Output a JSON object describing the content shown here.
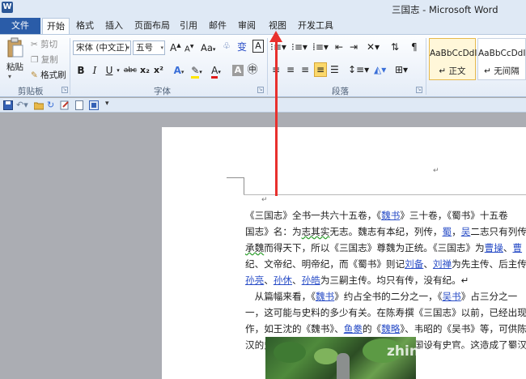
{
  "window": {
    "title": "三国志 - Microsoft Word",
    "app_icon": "W"
  },
  "tabs": {
    "file": "文件",
    "items": [
      "开始",
      "格式",
      "插入",
      "页面布局",
      "引用",
      "邮件",
      "审阅",
      "视图",
      "开发工具"
    ],
    "active": "开始"
  },
  "ribbon": {
    "clipboard": {
      "label": "剪贴板",
      "paste": "粘贴",
      "cut": "剪切",
      "copy": "复制",
      "format_painter": "格式刷"
    },
    "font": {
      "label": "字体",
      "font_name": "宋体 (中文正)",
      "font_size": "五号",
      "bold": "B",
      "italic": "I",
      "underline": "U",
      "strike": "abc",
      "subscript": "x₂",
      "superscript": "x²",
      "grow": "A",
      "shrink": "A",
      "change_case": "Aa",
      "phonetic": "wén",
      "char_border": "A"
    },
    "paragraph": {
      "label": "段落"
    },
    "styles": {
      "items": [
        {
          "sample": "AaBbCcDdI",
          "name": "↵ 正文",
          "selected": true
        },
        {
          "sample": "AaBbCcDdI",
          "name": "↵ 无间隔",
          "selected": false
        }
      ]
    }
  },
  "document": {
    "lines": [
      {
        "parts": [
          [
            "t",
            "《三国志》全书一共六十五卷，《"
          ],
          [
            "l",
            "魏书"
          ],
          [
            "t",
            "》三十卷，《蜀书》十五卷"
          ]
        ]
      },
      {
        "parts": [
          [
            "t",
            "国志》名：为"
          ],
          [
            "w",
            "志其实"
          ],
          [
            "t",
            "无志。魏志有本纪，列传，"
          ],
          [
            "l",
            "蜀"
          ],
          [
            "t",
            "，"
          ],
          [
            "l",
            "吴"
          ],
          [
            "t",
            "二志只有列传"
          ]
        ]
      },
      {
        "parts": [
          [
            "w",
            "承魏"
          ],
          [
            "t",
            "而得天下，所以《三国志》尊魏为正统。《三国志》为"
          ],
          [
            "l",
            "曹操"
          ],
          [
            "t",
            "、"
          ],
          [
            "l",
            "曹"
          ]
        ]
      },
      {
        "parts": [
          [
            "t",
            "纪、文帝纪、明帝纪，而《蜀书》则记"
          ],
          [
            "l",
            "刘备"
          ],
          [
            "t",
            "、"
          ],
          [
            "l",
            "刘禅"
          ],
          [
            "t",
            "为先主传、后主传"
          ]
        ]
      },
      {
        "parts": [
          [
            "l",
            "孙亮"
          ],
          [
            "t",
            "、"
          ],
          [
            "l",
            "孙休"
          ],
          [
            "t",
            "、"
          ],
          [
            "l",
            "孙皓"
          ],
          [
            "t",
            "为三嗣主传。均只有传，没有纪。↵"
          ]
        ]
      },
      {
        "parts": [
          [
            "t",
            "　从篇幅来看，《"
          ],
          [
            "l",
            "魏书"
          ],
          [
            "t",
            "》约占全书的二分之一，《"
          ],
          [
            "l",
            "吴书"
          ],
          [
            "t",
            "》占三分之一"
          ]
        ]
      },
      {
        "parts": [
          [
            "t",
            "一，这可能与史料的多少有关。在陈寿撰《三国志》以前，已经出现"
          ]
        ]
      },
      {
        "parts": [
          [
            "t",
            "作，如王沈的《魏书》、"
          ],
          [
            "l",
            "鱼豢"
          ],
          [
            "t",
            "的《"
          ],
          [
            "l",
            "魏略"
          ],
          [
            "t",
            "》、韦昭的《吴书》等，可供陈"
          ]
        ]
      },
      {
        "parts": [
          [
            "t",
            "汉的史作阙如，而且蜀汉也不像"
          ],
          [
            "l",
            "魏"
          ],
          [
            "t",
            "、吴二国设有史官。这造成了蜀汉"
          ]
        ]
      }
    ]
  },
  "watermark": "zhinan.sogou.com",
  "colors": {
    "accent": "#2a5ca8",
    "link": "#2a4ec7",
    "arrow": "#e8302d"
  }
}
